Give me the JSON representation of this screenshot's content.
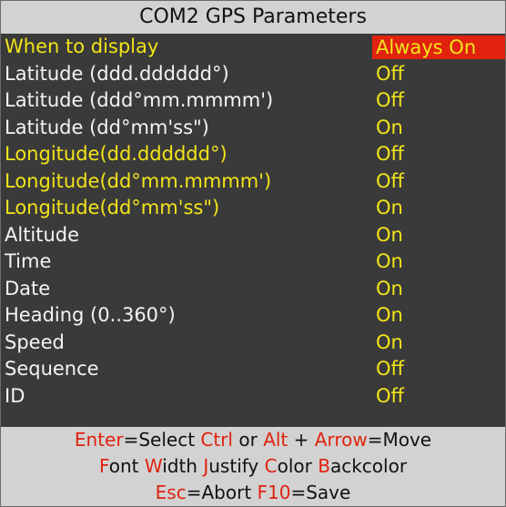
{
  "title": "COM2 GPS Parameters",
  "colors": {
    "yellow": "#f2e41a",
    "white": "#f4f4f4",
    "red": "#e0220e",
    "panel_bg": "#3a3a3a",
    "bar_bg": "#d2d2d2"
  },
  "rows": [
    {
      "label": "When to display",
      "value": "Always On",
      "label_color": "#f2e41a",
      "value_color": "#f2e41a",
      "highlight": true
    },
    {
      "label": "Latitude (ddd.dddddd°)",
      "value": "Off",
      "label_color": "#f4f4f4",
      "value_color": "#f2e41a"
    },
    {
      "label": "Latitude (ddd°mm.mmmm')",
      "value": "Off",
      "label_color": "#f4f4f4",
      "value_color": "#f2e41a"
    },
    {
      "label": "Latitude (dd°mm'ss\")",
      "value": "On",
      "label_color": "#f4f4f4",
      "value_color": "#f2e41a"
    },
    {
      "label": "Longitude(dd.dddddd°)",
      "value": "Off",
      "label_color": "#f2e41a",
      "value_color": "#f2e41a"
    },
    {
      "label": "Longitude(dd°mm.mmmm')",
      "value": "Off",
      "label_color": "#f2e41a",
      "value_color": "#f2e41a"
    },
    {
      "label": "Longitude(dd°mm'ss\")",
      "value": "On",
      "label_color": "#f2e41a",
      "value_color": "#f2e41a"
    },
    {
      "label": "Altitude",
      "value": "On",
      "label_color": "#f4f4f4",
      "value_color": "#f2e41a"
    },
    {
      "label": "Time",
      "value": "On",
      "label_color": "#f4f4f4",
      "value_color": "#f2e41a"
    },
    {
      "label": "Date",
      "value": "On",
      "label_color": "#f4f4f4",
      "value_color": "#f2e41a"
    },
    {
      "label": "Heading (0..360°)",
      "value": "On",
      "label_color": "#f4f4f4",
      "value_color": "#f2e41a"
    },
    {
      "label": "Speed",
      "value": "On",
      "label_color": "#f4f4f4",
      "value_color": "#f2e41a"
    },
    {
      "label": "Sequence",
      "value": "Off",
      "label_color": "#f4f4f4",
      "value_color": "#f2e41a"
    },
    {
      "label": "ID",
      "value": "Off",
      "label_color": "#f4f4f4",
      "value_color": "#f2e41a"
    }
  ],
  "footer": {
    "line1": {
      "enter_key": "Enter",
      "select_text": "=Select ",
      "ctrl_key": "Ctrl",
      "or_text": " or ",
      "alt_key": "Alt",
      "plus_text": " + ",
      "arrow_key": "Arrow",
      "move_text": "=Move"
    },
    "line2": {
      "font_key": "F",
      "font_rest": "ont ",
      "width_key": "W",
      "width_rest": "idth ",
      "justify_key": "J",
      "justify_rest": "ustify ",
      "color_key": "C",
      "color_rest": "olor ",
      "backcolor_key": "B",
      "backcolor_rest": "ackcolor"
    },
    "line3": {
      "esc_key": "Esc",
      "abort_text": "=Abort ",
      "f10_key": "F10",
      "save_text": "=Save"
    }
  }
}
